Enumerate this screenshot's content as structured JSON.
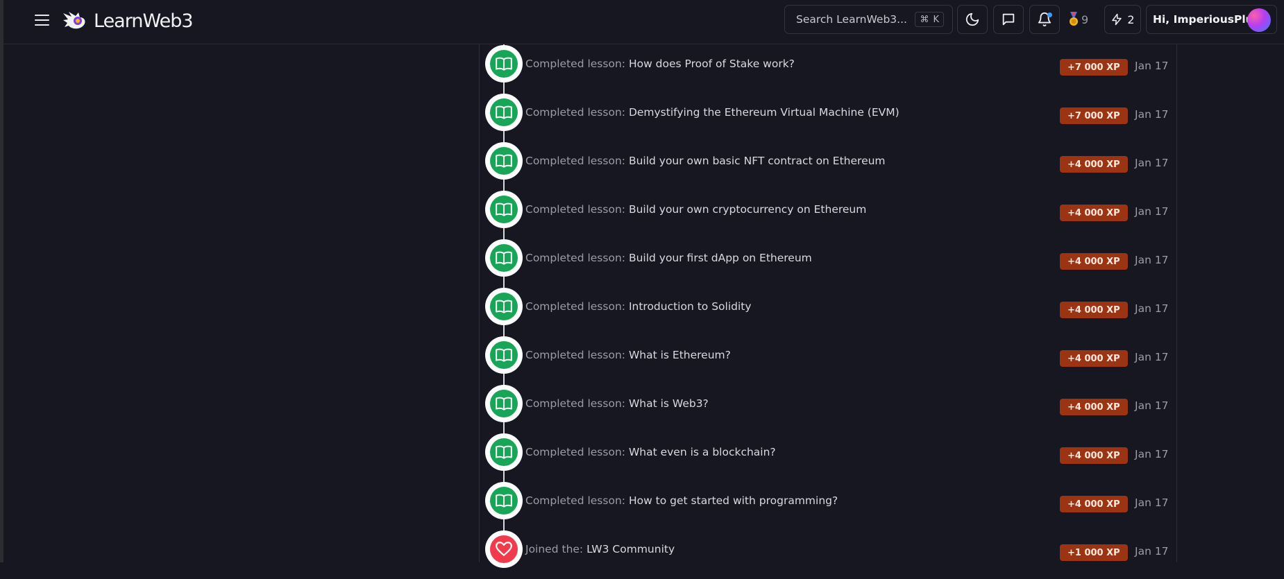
{
  "header": {
    "logo_text": "LearnWeb3",
    "search_placeholder": "Search LearnWeb3...",
    "search_shortcut_symbol": "⌘",
    "search_shortcut_key": "K",
    "badges_count": "9",
    "energy_count": "2",
    "greeting": "Hi, ImperiousPlug!"
  },
  "timeline": {
    "items": [
      {
        "prefix": "Completed lesson:",
        "title": "How does Proof of Stake work?",
        "xp": "+7 000 XP",
        "date": "Jan 17",
        "icon": "book-icon",
        "color": "#19a557"
      },
      {
        "prefix": "Completed lesson:",
        "title": "Demystifying the Ethereum Virtual Machine (EVM)",
        "xp": "+7 000 XP",
        "date": "Jan 17",
        "icon": "book-icon",
        "color": "#19a557"
      },
      {
        "prefix": "Completed lesson:",
        "title": "Build your own basic NFT contract on Ethereum",
        "xp": "+4 000 XP",
        "date": "Jan 17",
        "icon": "book-icon",
        "color": "#19a557"
      },
      {
        "prefix": "Completed lesson:",
        "title": "Build your own cryptocurrency on Ethereum",
        "xp": "+4 000 XP",
        "date": "Jan 17",
        "icon": "book-icon",
        "color": "#19a557"
      },
      {
        "prefix": "Completed lesson:",
        "title": "Build your first dApp on Ethereum",
        "xp": "+4 000 XP",
        "date": "Jan 17",
        "icon": "book-icon",
        "color": "#19a557"
      },
      {
        "prefix": "Completed lesson:",
        "title": "Introduction to Solidity",
        "xp": "+4 000 XP",
        "date": "Jan 17",
        "icon": "book-icon",
        "color": "#19a557"
      },
      {
        "prefix": "Completed lesson:",
        "title": "What is Ethereum?",
        "xp": "+4 000 XP",
        "date": "Jan 17",
        "icon": "book-icon",
        "color": "#19a557"
      },
      {
        "prefix": "Completed lesson:",
        "title": "What is Web3?",
        "xp": "+4 000 XP",
        "date": "Jan 17",
        "icon": "book-icon",
        "color": "#19a557"
      },
      {
        "prefix": "Completed lesson:",
        "title": "What even is a blockchain?",
        "xp": "+4 000 XP",
        "date": "Jan 17",
        "icon": "book-icon",
        "color": "#19a557"
      },
      {
        "prefix": "Completed lesson:",
        "title": "How to get started with programming?",
        "xp": "+4 000 XP",
        "date": "Jan 17",
        "icon": "book-icon",
        "color": "#19a557"
      },
      {
        "prefix": "Joined the:",
        "title": "LW3 Community",
        "xp": "+1 000 XP",
        "date": "Jan 17",
        "icon": "heart-icon",
        "color": "#ef3b4b"
      }
    ]
  },
  "colors": {
    "background": "#171722",
    "xp_badge": "#9b3412",
    "lesson_green": "#19a557",
    "community_red": "#ef3b4b"
  }
}
